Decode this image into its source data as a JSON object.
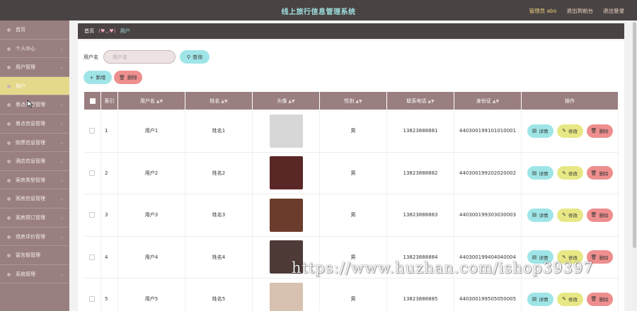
{
  "header": {
    "title": "线上旅行信息管理系统",
    "admin": "管理员 abo",
    "back_to_front": "退出到前台",
    "logout": "退出登录"
  },
  "sidebar": {
    "items": [
      {
        "label": "首页",
        "active": false,
        "caret": false
      },
      {
        "label": "个人中心",
        "active": false,
        "caret": true
      },
      {
        "label": "用户管理",
        "active": false,
        "caret": true
      },
      {
        "label": "用户",
        "active": true,
        "caret": false
      },
      {
        "label": "景点类型管理",
        "active": false,
        "caret": true
      },
      {
        "label": "景点信息管理",
        "active": false,
        "caret": true
      },
      {
        "label": "购票信息管理",
        "active": false,
        "caret": true
      },
      {
        "label": "酒店信息管理",
        "active": false,
        "caret": true
      },
      {
        "label": "客房类型管理",
        "active": false,
        "caret": true
      },
      {
        "label": "客房信息管理",
        "active": false,
        "caret": true
      },
      {
        "label": "客房预订管理",
        "active": false,
        "caret": true
      },
      {
        "label": "退房评价管理",
        "active": false,
        "caret": true
      },
      {
        "label": "留言板管理",
        "active": false,
        "caret": false
      },
      {
        "label": "系统管理",
        "active": false,
        "caret": true
      }
    ]
  },
  "breadcrumb": {
    "home": "首页",
    "emoticon": "(♥◡♥)",
    "current": "用户"
  },
  "search": {
    "label": "用户名",
    "placeholder": "用户名",
    "button": "查询"
  },
  "actions": {
    "add": "新增",
    "delete": "删除"
  },
  "table": {
    "columns": [
      "索引",
      "用户名",
      "姓名",
      "头像",
      "性别",
      "联系电话",
      "身份证",
      "操作"
    ],
    "row_actions": {
      "detail": "详情",
      "edit": "修改",
      "remove": "删除"
    },
    "rows": [
      {
        "index": "1",
        "username": "用户1",
        "name": "姓名1",
        "gender": "男",
        "phone": "13823888881",
        "id_card": "440300199101010001",
        "avatar_color": "#d7d7d7"
      },
      {
        "index": "2",
        "username": "用户2",
        "name": "姓名2",
        "gender": "男",
        "phone": "13823888882",
        "id_card": "440300199202020002",
        "avatar_color": "#5a2727"
      },
      {
        "index": "3",
        "username": "用户3",
        "name": "姓名3",
        "gender": "男",
        "phone": "13823888883",
        "id_card": "440300199303030003",
        "avatar_color": "#6b3c2c"
      },
      {
        "index": "4",
        "username": "用户4",
        "name": "姓名4",
        "gender": "男",
        "phone": "13823888884",
        "id_card": "440300199404040004",
        "avatar_color": "#4e3b38"
      },
      {
        "index": "5",
        "username": "用户5",
        "name": "姓名5",
        "gender": "男",
        "phone": "13823888885",
        "id_card": "440300199505050005",
        "avatar_color": "#d8c1b0"
      }
    ]
  },
  "watermark": "https://www.huzhan.com/ishop39397",
  "colors": {
    "header_bg": "#4a4343",
    "sidebar_bg": "#9a7f80",
    "active_item": "#e6d88a",
    "accent_cyan": "#9fe5e8",
    "accent_yellow": "#e7e885",
    "accent_red": "#ee8e8e"
  }
}
